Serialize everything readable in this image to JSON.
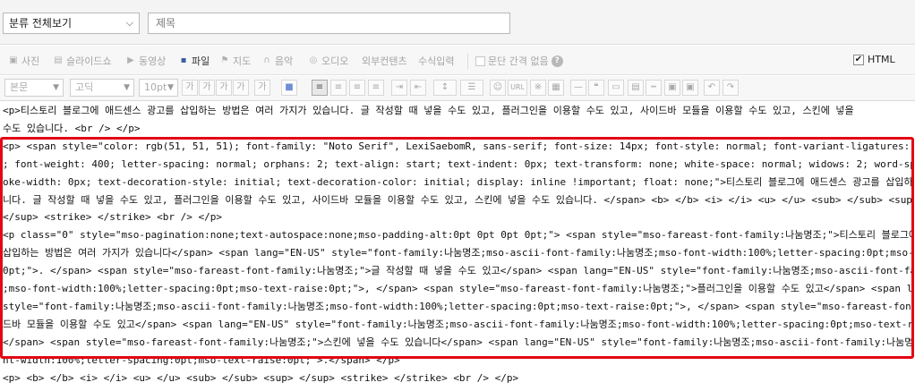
{
  "header": {
    "category": "분류 전체보기",
    "title_placeholder": "제목"
  },
  "media_toolbar": {
    "photo": "사진",
    "slideshow": "슬라이드쇼",
    "video": "동영상",
    "file": "파일",
    "map": "지도",
    "music": "음악",
    "audio": "오디오",
    "external": "외부컨텐츠",
    "formula": "수식입력",
    "paragraph_spacing": "문단 간격 없음",
    "help": "?",
    "html_mode": "HTML",
    "html_checked": "✔"
  },
  "format_toolbar": {
    "block_style": "본문",
    "font": "고딕",
    "size": "10pt",
    "buttons": {
      "bold": "가",
      "underline": "가",
      "strike": "가",
      "italic": "가",
      "color": "가",
      "bgcolor": "■",
      "align_left": "≡",
      "align_center": "≡",
      "align_right": "≡",
      "align_justify": "≡",
      "indent": "⇥",
      "outdent": "⇤",
      "line_height": "↕",
      "list": "☰",
      "emoticon": "☺",
      "url": "URL",
      "special_char": "※",
      "table": "▦",
      "hr": "—",
      "quote": "❝",
      "box": "▭",
      "more": "▤",
      "break": "┅",
      "save": "▣",
      "undo": "↶",
      "redo": "↷"
    }
  },
  "editor": {
    "lines": [
      "<p>티스토리 블로그에 애드센스 광고를 삽입하는 방법은 여러 가지가 있습니다. 글 작성할 때 넣을 수도 있고, 플러그인을 이용할 수도 있고, 사이드바 모듈을 이용할 수도 있고, 스킨에 넣을",
      "수도 있습니다. <br /> </p>",
      "<p> <span style=\"color: rgb(51, 51, 51); font-family: \"Noto Serif\", LexiSaebomR, sans-serif; font-size: 14px; font-style: normal; font-variant-ligatures: normal; font-variant-caps: norma",
      "; font-weight: 400; letter-spacing: normal; orphans: 2; text-align: start; text-indent: 0px; text-transform: none; white-space: normal; widows: 2; word-spacing: 0.5px; -webkit-text-str",
      "oke-width: 0px; text-decoration-style: initial; text-decoration-color: initial; display: inline !important; float: none;\">티스토리 블로그에 애드센스 광고를 삽입하는 방법은 여러 가지가 있습",
      "니다. 글 작성할 때 넣을 수도 있고, 플러그인을 이용할 수도 있고, 사이드바 모듈을 이용할 수도 있고, 스킨에 넣을 수도 있습니다. </span> <b> </b> <i> </i> <u> </u> <sub> </sub> <sup>",
      "</sup> <strike> </strike> <br /> </p>",
      "<p class=\"0\" style=\"mso-pagination:none;text-autospace:none;mso-padding-alt:0pt 0pt 0pt 0pt;\"> <span style=\"mso-fareast-font-family:나눔명조;\">티스토리 블로그에 애드센스 광고를",
      "삽입하는 방법은 여러 가지가 있습니다</span> <span lang=\"EN-US\" style=\"font-family:나눔명조;mso-ascii-font-family:나눔명조;mso-font-width:100%;letter-spacing:0pt;mso-text-raise:",
      "0pt;\">. </span> <span style=\"mso-fareast-font-family:나눔명조;\">글 작성할 때 넣을 수도 있고</span> <span lang=\"EN-US\" style=\"font-family:나눔명조;mso-ascii-font-family:나눔명조",
      ";mso-font-width:100%;letter-spacing:0pt;mso-text-raise:0pt;\">, </span> <span style=\"mso-fareast-font-family:나눔명조;\">플러그인을 이용할 수도 있고</span> <span lang=\"EN-US\"",
      "style=\"font-family:나눔명조;mso-ascii-font-family:나눔명조;mso-font-width:100%;letter-spacing:0pt;mso-text-raise:0pt;\">, </span> <span style=\"mso-fareast-font-family:나눔명조;\">사이",
      "드바 모듈을 이용할 수도 있고</span> <span lang=\"EN-US\" style=\"font-family:나눔명조;mso-ascii-font-family:나눔명조;mso-font-width:100%;letter-spacing:0pt;mso-text-raise:0pt;\">,",
      "</span> <span style=\"mso-fareast-font-family:나눔명조;\">스킨에 넣을 수도 있습니다</span> <span lang=\"EN-US\" style=\"font-family:나눔명조;mso-ascii-font-family:나눔명조;mso-fo",
      "nt-width:100%;letter-spacing:0pt;mso-text-raise:0pt;\">.</span> </p>",
      "<p> <b> </b> <i> </i> <u> </u> <sub> </sub> <sup> </sup> <strike> </strike> <br /> </p>"
    ]
  }
}
